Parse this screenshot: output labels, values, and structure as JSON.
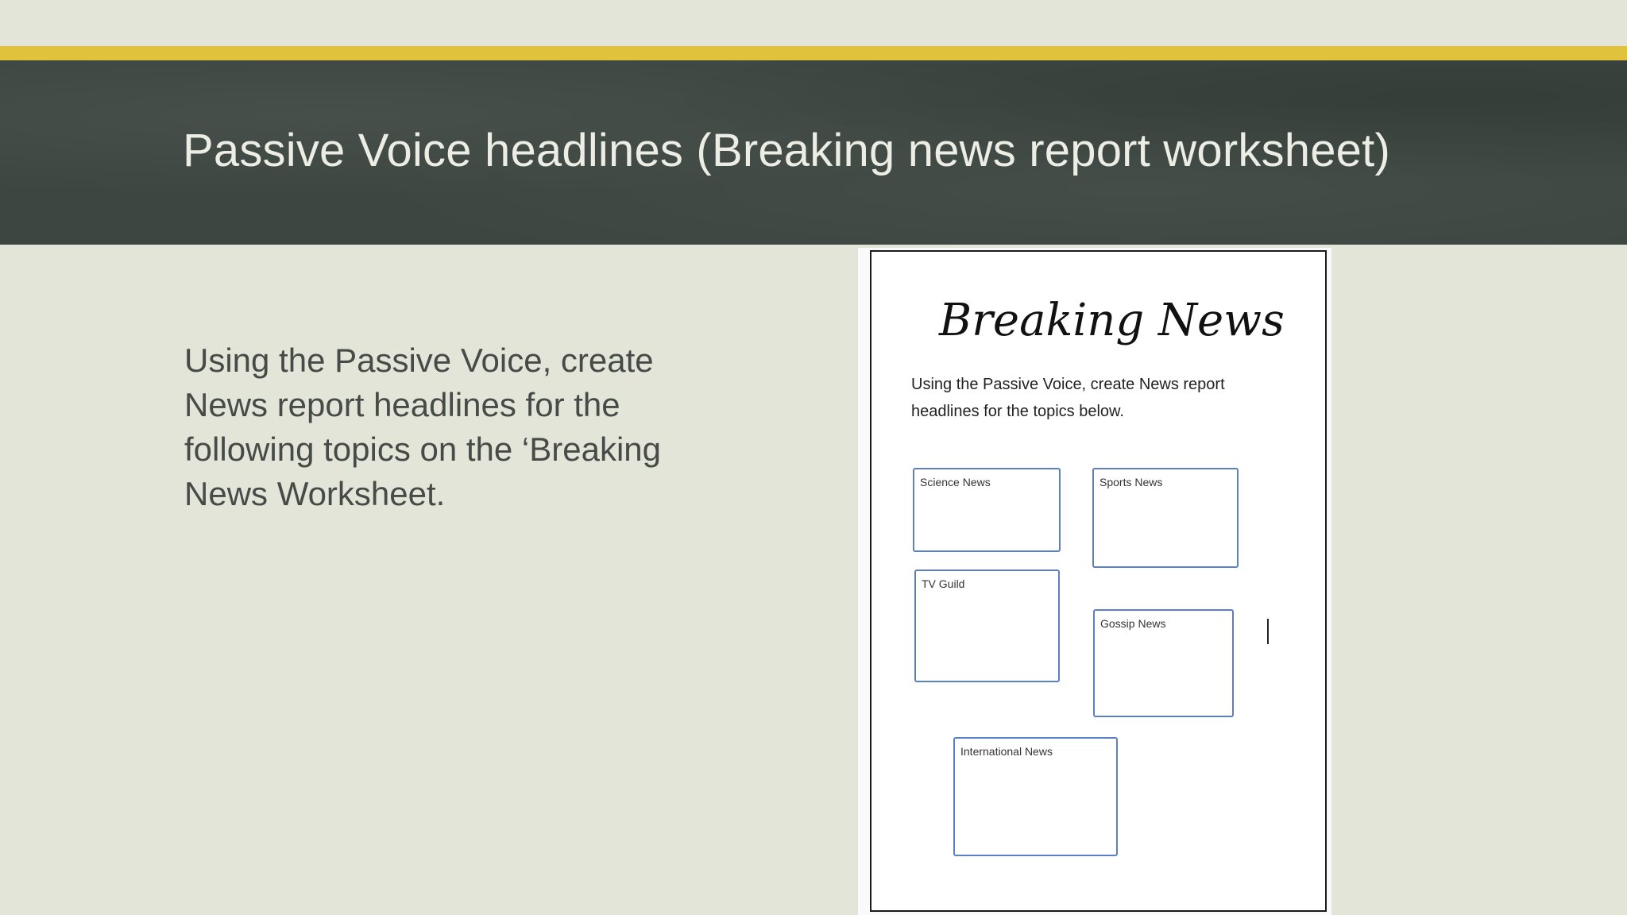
{
  "slide": {
    "title": "Passive Voice headlines  (Breaking news report worksheet)",
    "body": "Using the Passive Voice, create News report headlines for the following topics on the ‘Breaking News Worksheet."
  },
  "worksheet": {
    "title": "Breaking News",
    "instructions": "Using the Passive Voice, create News report headlines for the topics below.",
    "boxes": [
      {
        "label": "Science News"
      },
      {
        "label": "Sports News"
      },
      {
        "label": "TV Guild"
      },
      {
        "label": "Gossip News"
      },
      {
        "label": "International News"
      }
    ]
  },
  "colors": {
    "background": "#e3e5d9",
    "accent_bar": "#e0c23c",
    "header_band": "#3d4641",
    "title_text": "#ecede4",
    "body_text": "#474b47",
    "box_border": "#5b7fc8"
  }
}
